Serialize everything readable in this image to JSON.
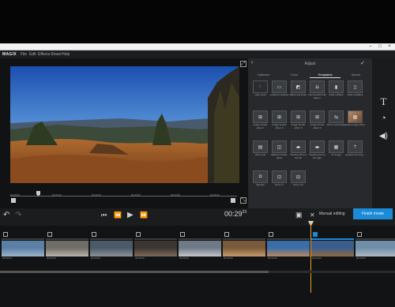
{
  "window": {
    "minimize": "–",
    "maximize": "□",
    "close": "×"
  },
  "menu": {
    "logo": "MAGIX",
    "items": [
      "File",
      "Edit",
      "Effects",
      "Share",
      "Help"
    ]
  },
  "preview": {
    "marks": [
      "00:00:00",
      "00:01:00",
      "00:02:00",
      "00:03:00",
      "00:04:00",
      "00:05:00"
    ]
  },
  "panel": {
    "title": "Adjust",
    "back_icon": "back-icon",
    "ok_icon": "check-icon",
    "tabs": [
      "Optimize",
      "Color",
      "Templates",
      "Speed"
    ],
    "active_tab": 2,
    "templates": [
      {
        "label": "Little world",
        "glyph": "◌"
      },
      {
        "label": "Letterbox vignette",
        "glyph": "▭"
      },
      {
        "label": "Black and white",
        "glyph": "◩"
      },
      {
        "label": "Fast-forward with fade in",
        "glyph": "⇊"
      },
      {
        "label": "Fade-in/black",
        "glyph": "▮"
      },
      {
        "label": "Fade out/black",
        "glyph": "▯"
      },
      {
        "label": "Image border effect 1",
        "glyph": "⊞"
      },
      {
        "label": "Image border effect 2",
        "glyph": "⊞"
      },
      {
        "label": "Image border effect 3",
        "glyph": "⊞"
      },
      {
        "label": "Image border effect 4",
        "glyph": "⊞"
      },
      {
        "label": "Mirror horizontally",
        "glyph": "⇆"
      },
      {
        "label": "Sepia image effect",
        "glyph": "▩"
      },
      {
        "label": "Old movie",
        "glyph": "▤"
      },
      {
        "label": "Balance border effect",
        "glyph": "◫"
      },
      {
        "label": "Tracking shot to the left",
        "glyph": "◂▸"
      },
      {
        "label": "Tracking shot to the right",
        "glyph": "◂▸"
      },
      {
        "label": "TV image",
        "glyph": "▦"
      },
      {
        "label": "Upward zooming...",
        "glyph": "⇡"
      },
      {
        "label": "Vignette",
        "glyph": "◘"
      },
      {
        "label": "Zoom in",
        "glyph": "⊡"
      },
      {
        "label": "Zoom out",
        "glyph": "⊟"
      }
    ]
  },
  "rightbar": {
    "icons": [
      "text-icon",
      "speedometer-icon",
      "volume-icon"
    ]
  },
  "controls": {
    "timecode": "00:29",
    "timecode_frames": "23",
    "manual_label": "Manual editing",
    "export_label": "Finish movie"
  },
  "timeline": {
    "clips": [
      {
        "dur": "00:00:00",
        "sel": false,
        "c1": "#5b7fa6",
        "c2": "#9ab4c9"
      },
      {
        "dur": "00:00:00",
        "sel": false,
        "c1": "#6f6d67",
        "c2": "#b9b3a6"
      },
      {
        "dur": "00:00:00",
        "sel": false,
        "c1": "#4a5a66",
        "c2": "#8a9299"
      },
      {
        "dur": "00:00:00",
        "sel": false,
        "c1": "#3b3631",
        "c2": "#7d6a5a"
      },
      {
        "dur": "00:00:00",
        "sel": false,
        "c1": "#6f7a87",
        "c2": "#c3c7cc"
      },
      {
        "dur": "00:00:00",
        "sel": false,
        "c1": "#7a5a3a",
        "c2": "#c49a6a"
      },
      {
        "dur": "00:00:00",
        "sel": false,
        "c1": "#3b6ea8",
        "c2": "#b88860"
      },
      {
        "dur": "00:00:00",
        "sel": true,
        "c1": "#3a5d8f",
        "c2": "#8f6a3e"
      },
      {
        "dur": "00:00:00",
        "sel": false,
        "c1": "#6f8fa8",
        "c2": "#aeb9c3"
      }
    ]
  },
  "colors": {
    "accent": "#1a8ad9",
    "playhead": "#f0a020"
  }
}
